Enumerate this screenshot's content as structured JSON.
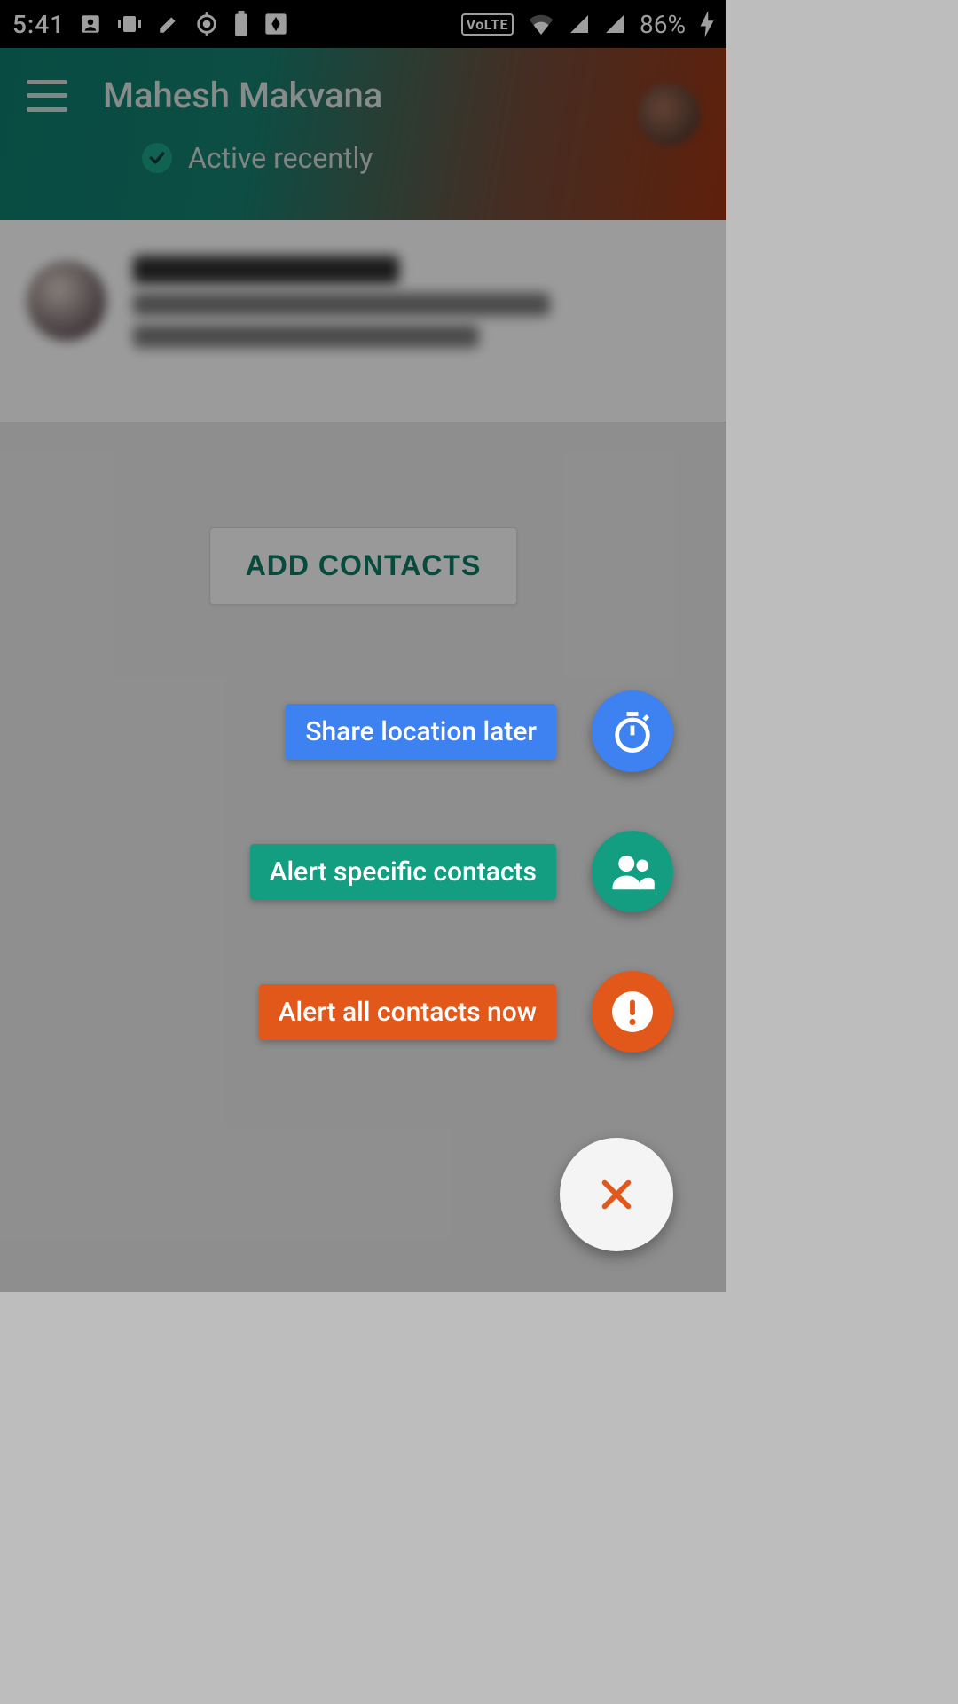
{
  "status_bar": {
    "clock": "5:41",
    "battery_percent": "86%",
    "volte_label": "VoLTE"
  },
  "header": {
    "title": "Mahesh Makvana",
    "presence": "Active recently"
  },
  "main": {
    "add_contacts_label": "ADD CONTACTS"
  },
  "fab_menu": {
    "share_later": "Share location later",
    "alert_specific": "Alert specific contacts",
    "alert_all": "Alert all contacts now"
  },
  "colors": {
    "accent_teal": "#139e82",
    "accent_blue": "#3d82f0",
    "accent_orange": "#e2571a"
  }
}
